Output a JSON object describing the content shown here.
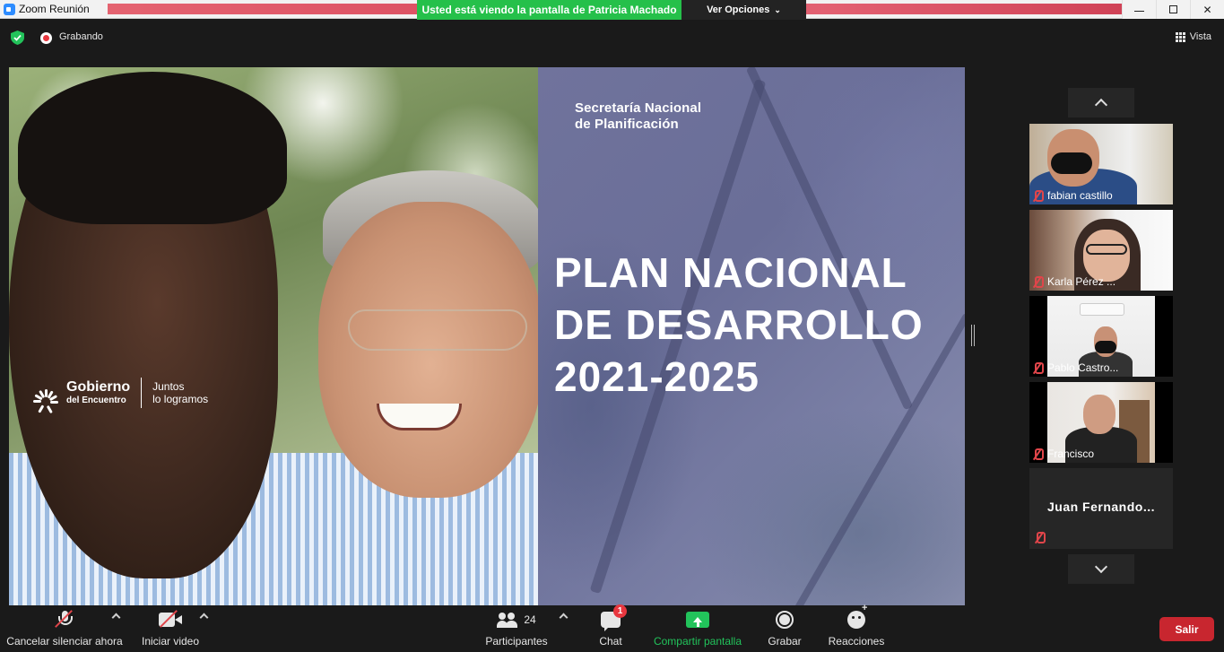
{
  "window": {
    "title": "Zoom Reunión",
    "share_banner": "Usted está viendo la pantalla de Patricia Machado",
    "view_options": "Ver Opciones",
    "minimize_icon": "minimize-icon",
    "maximize_icon": "restore-icon",
    "close_icon": "close-icon",
    "close_glyph": "✕"
  },
  "topbar": {
    "recording_label": "Grabando",
    "view_label": "Vista",
    "security_color": "#23c35b",
    "recording_color": "#e8373f"
  },
  "slide": {
    "org_line1": "Secretaría Nacional",
    "org_line2": "de Planificación",
    "title_line1": "PLAN NACIONAL",
    "title_line2": "DE DESARROLLO",
    "title_line3": "2021-2025",
    "logo_main": "Gobierno",
    "logo_sub": "del Encuentro",
    "logo_tag1": "Juntos",
    "logo_tag2": "lo logramos"
  },
  "participants": [
    {
      "name": "fabian castillo",
      "muted": true
    },
    {
      "name": "Karla Pérez ...",
      "muted": true
    },
    {
      "name": "Pablo Castro...",
      "muted": true
    },
    {
      "name": "Francisco",
      "muted": true
    },
    {
      "name": "Juan  Fernando...",
      "muted": true
    }
  ],
  "toolbar": {
    "mute_label": "Cancelar silenciar ahora",
    "video_label": "Iniciar video",
    "participants_label": "Participantes",
    "participants_count": "24",
    "chat_label": "Chat",
    "chat_badge": "1",
    "share_label": "Compartir pantalla",
    "record_label": "Grabar",
    "reactions_label": "Reacciones",
    "leave_label": "Salir",
    "share_color": "#22c35b",
    "leave_color": "#c8262f"
  }
}
